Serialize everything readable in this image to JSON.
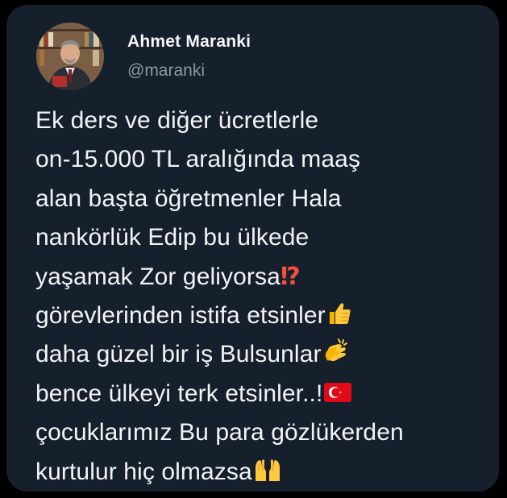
{
  "tweet": {
    "author_name": "Ahmet Maranki",
    "author_handle": "@maranki",
    "lines": [
      "Ek ders ve diğer ücretlerle",
      "on-15.000 TL aralığında maaş",
      "alan başta öğretmenler  Hala",
      "nankörlük Edip bu ülkede",
      "yaşamak Zor geliyorsa",
      "görevlerinden istifa etsinler",
      "daha güzel bir iş Bulsunlar",
      "bence ülkeyi terk etsinler..!",
      "çocuklarımız Bu para gözlükerden",
      "kurtulur hiç olmazsa"
    ],
    "emoji": {
      "line5": "⁉",
      "line6": "thumbs-up",
      "line7": "clapping-hands",
      "line8": "turkey-flag",
      "line10": "raising-hands"
    }
  },
  "colors": {
    "card_background": "#161f2c",
    "page_background": "#000000",
    "text": "#f2f4f6",
    "handle": "#8b98a5",
    "interrobang": "#f0503c",
    "flag_red": "#e30a17"
  }
}
